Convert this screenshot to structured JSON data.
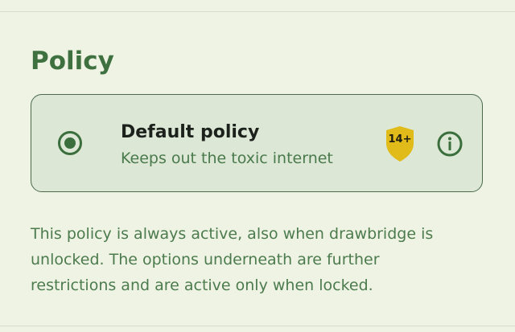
{
  "section": {
    "title": "Policy"
  },
  "policy_card": {
    "name": "Default policy",
    "description": "Keeps out the toxic internet",
    "selected": true,
    "age_rating": "14+",
    "age_rating_color": "#e0bb1a",
    "icons": {
      "radio": "radio-selected-icon",
      "badge": "shield-badge-icon",
      "info": "info-circle-icon"
    }
  },
  "explanation": "This policy is always active, also when drawbridge is unlocked. The options underneath are further restrictions and are active only when locked.",
  "colors": {
    "accent": "#3e7040",
    "background": "#eff3e4",
    "card_background": "#dce7d6"
  }
}
